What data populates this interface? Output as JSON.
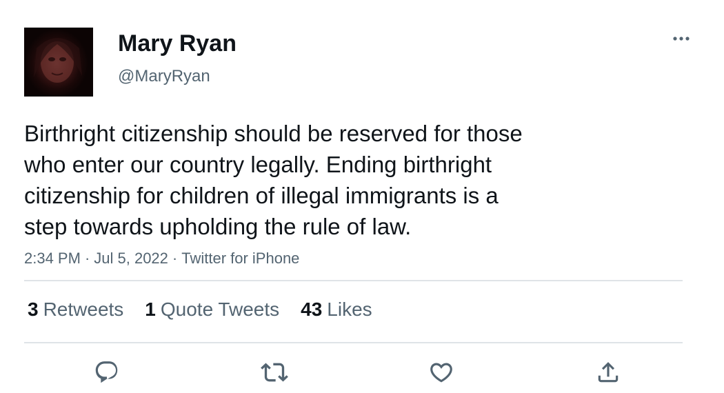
{
  "tweet": {
    "author": {
      "display_name": "Mary Ryan",
      "handle": "@MaryRyan"
    },
    "text": "Birthright citizenship should be reserved for those\nwho enter our country legally. Ending birthright\ncitizenship for children of illegal immigrants is a\nstep towards upholding the rule of law.",
    "time": "2:34 PM",
    "date": "Jul 5, 2022",
    "source": "Twitter for iPhone",
    "separator": "·",
    "stats": {
      "retweets_count": "3",
      "retweets_label": "Retweets",
      "quotes_count": "1",
      "quotes_label": "Quote Tweets",
      "likes_count": "43",
      "likes_label": "Likes"
    }
  },
  "icons": {
    "more": "more-horizontal-icon",
    "reply": "reply-icon",
    "retweet": "retweet-icon",
    "like": "heart-icon",
    "share": "share-icon"
  },
  "colors": {
    "text_primary": "#0f1419",
    "text_secondary": "#536471",
    "divider": "#dfe3e7",
    "icon": "#536471"
  }
}
